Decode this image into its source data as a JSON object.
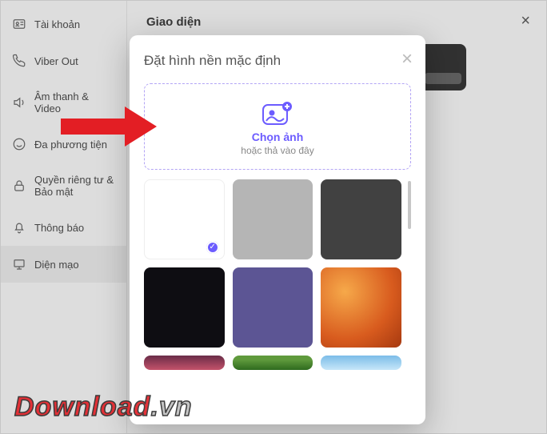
{
  "sidebar": {
    "items": [
      {
        "label": "Tài khoản",
        "icon": "id-card-icon"
      },
      {
        "label": "Viber Out",
        "icon": "phone-icon"
      },
      {
        "label": "Âm thanh & Video",
        "icon": "sound-icon"
      },
      {
        "label": "Đa phương tiện",
        "icon": "smiley-icon"
      },
      {
        "label": "Quyền riêng tư & Bảo mật",
        "icon": "lock-icon"
      },
      {
        "label": "Thông báo",
        "icon": "bell-icon"
      },
      {
        "label": "Diện mạo",
        "icon": "appearance-icon"
      }
    ]
  },
  "main": {
    "title": "Giao diện"
  },
  "modal": {
    "title": "Đặt hình nền mặc định",
    "upload_title": "Chọn ảnh",
    "upload_sub": "hoặc thả vào đây"
  },
  "watermark": {
    "text": "Download",
    "suffix": ".vn"
  }
}
